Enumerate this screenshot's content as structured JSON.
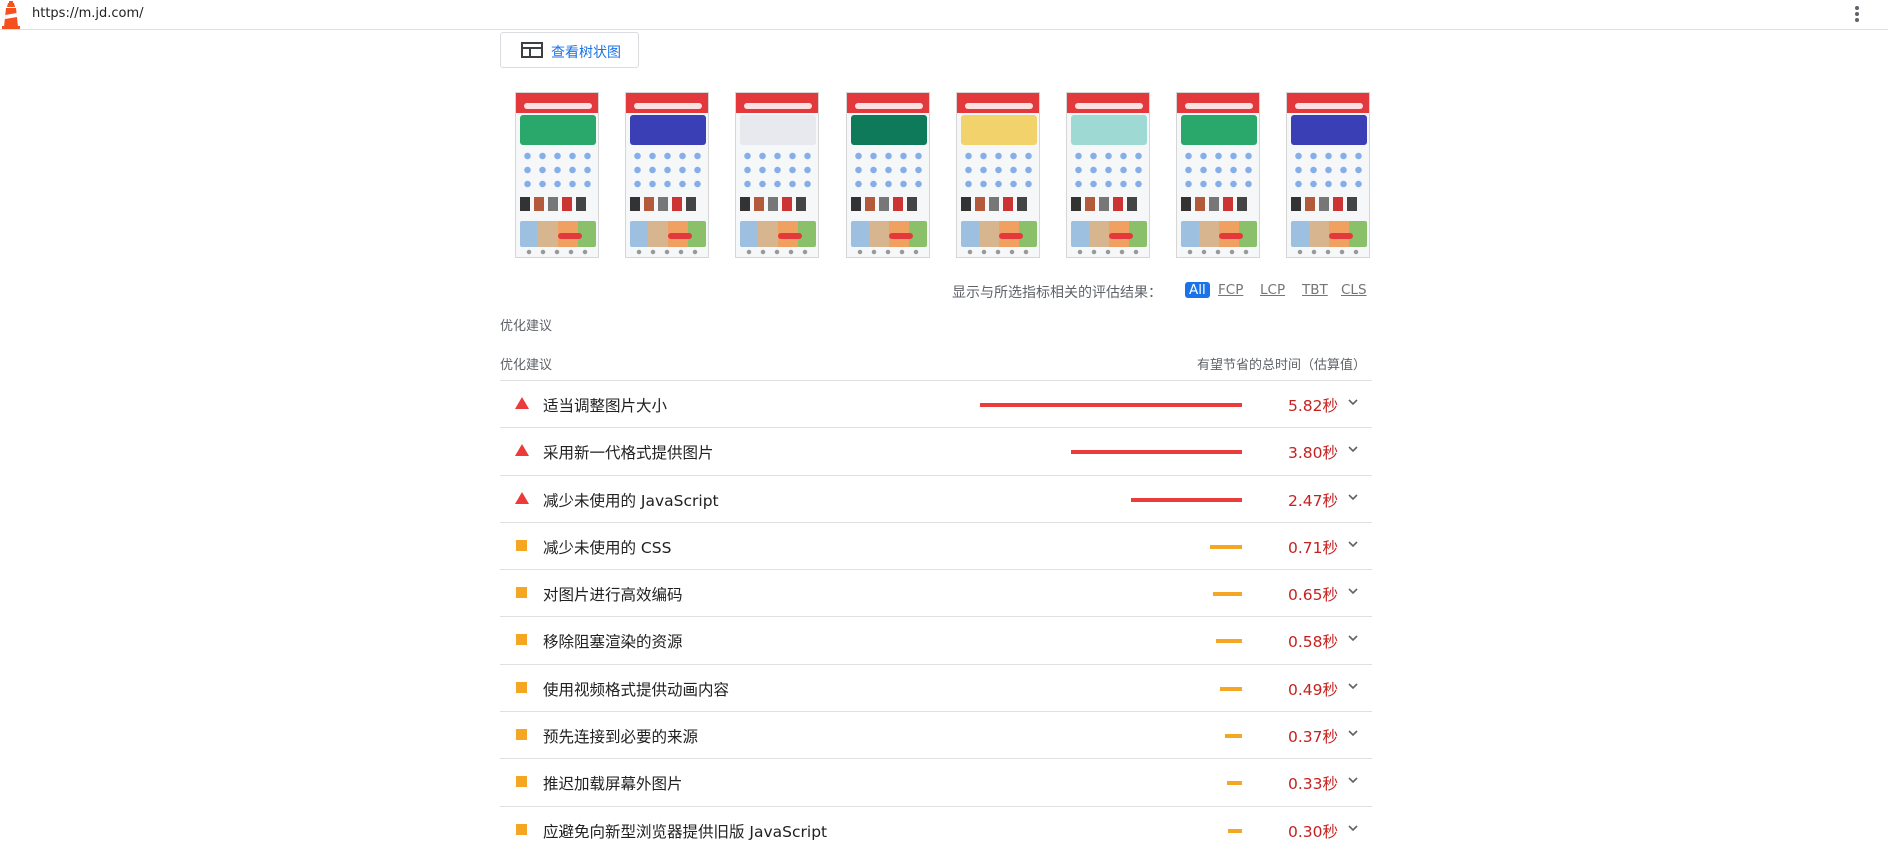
{
  "browser": {
    "url": "https://m.jd.com/"
  },
  "treemap": {
    "label": "查看树状图"
  },
  "filmstrip": {
    "frame_count": 8,
    "banner_colors": [
      "#2aa76b",
      "#3b3fb5",
      "#e7e9ee",
      "#0f7a5a",
      "#f2d36b",
      "#9fd9d3",
      "#2aa76b",
      "#3b3fb5"
    ]
  },
  "filter": {
    "label": "显示与所选指标相关的评估结果：",
    "chips": [
      {
        "label": "All",
        "active": true
      },
      {
        "label": "FCP",
        "active": false
      },
      {
        "label": "LCP",
        "active": false
      },
      {
        "label": "TBT",
        "active": false
      },
      {
        "label": "CLS",
        "active": false
      }
    ]
  },
  "section": {
    "title": "优化建议",
    "column_left": "优化建议",
    "column_right": "有望节省的总时间（估算值）"
  },
  "colors": {
    "fail": "#eb3b3b",
    "average": "#f5a623",
    "value_text": "#c5221f",
    "link": "#1a73e8"
  },
  "audits": [
    {
      "title": "适当调整图片大小",
      "savings": "5.82秒",
      "savings_seconds": 5.82,
      "rating": "fail"
    },
    {
      "title": "采用新一代格式提供图片",
      "savings": "3.80秒",
      "savings_seconds": 3.8,
      "rating": "fail"
    },
    {
      "title": "减少未使用的 JavaScript",
      "savings": "2.47秒",
      "savings_seconds": 2.47,
      "rating": "fail"
    },
    {
      "title": "减少未使用的 CSS",
      "savings": "0.71秒",
      "savings_seconds": 0.71,
      "rating": "average"
    },
    {
      "title": "对图片进行高效编码",
      "savings": "0.65秒",
      "savings_seconds": 0.65,
      "rating": "average"
    },
    {
      "title": "移除阻塞渲染的资源",
      "savings": "0.58秒",
      "savings_seconds": 0.58,
      "rating": "average"
    },
    {
      "title": "使用视频格式提供动画内容",
      "savings": "0.49秒",
      "savings_seconds": 0.49,
      "rating": "average"
    },
    {
      "title": "预先连接到必要的来源",
      "savings": "0.37秒",
      "savings_seconds": 0.37,
      "rating": "average"
    },
    {
      "title": "推迟加载屏幕外图片",
      "savings": "0.33秒",
      "savings_seconds": 0.33,
      "rating": "average"
    },
    {
      "title": "应避免向新型浏览器提供旧版 JavaScript",
      "savings": "0.30秒",
      "savings_seconds": 0.3,
      "rating": "average"
    }
  ]
}
